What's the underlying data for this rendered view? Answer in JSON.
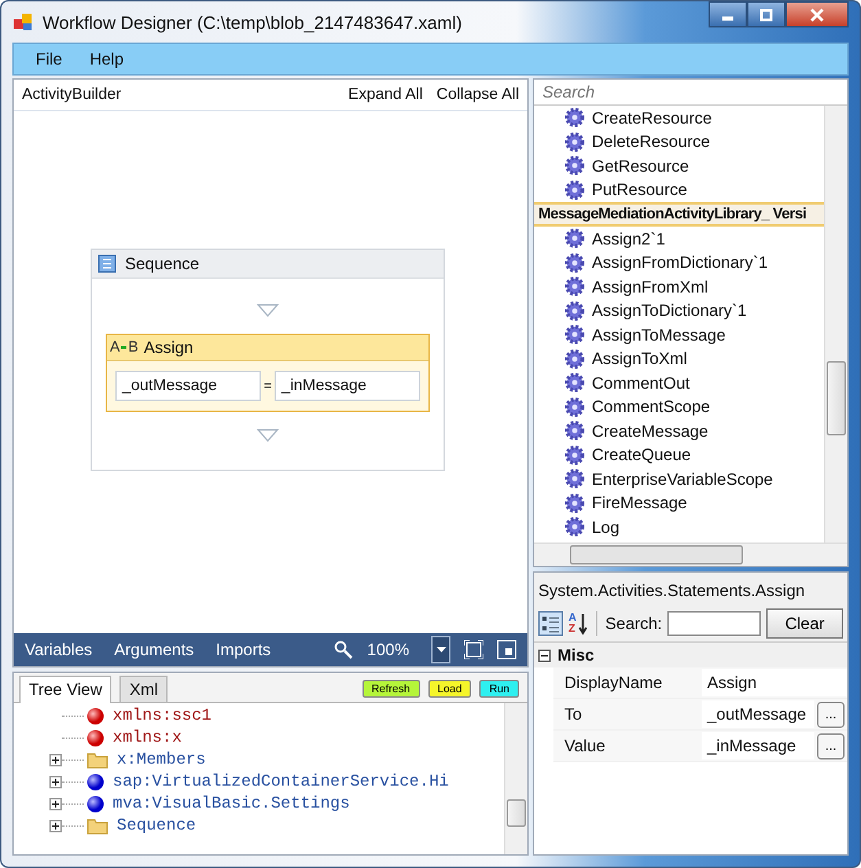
{
  "window": {
    "title": "Workflow Designer (C:\\temp\\blob_2147483647.xaml)"
  },
  "menu": [
    "File",
    "Help"
  ],
  "designer": {
    "breadcrumb": "ActivityBuilder",
    "actions": [
      "Expand All",
      "Collapse All"
    ],
    "sequence": {
      "title": "Sequence",
      "activity": {
        "icon_letters": [
          "A",
          "B"
        ],
        "title": "Assign",
        "selected": true,
        "to": "_outMessage",
        "operator": "=",
        "value": "_inMessage"
      }
    }
  },
  "designer_bar": {
    "tabs": [
      "Variables",
      "Arguments",
      "Imports"
    ],
    "zoom": "100%"
  },
  "tree_panel": {
    "tabs": [
      {
        "label": "Tree View",
        "selected": true
      },
      {
        "label": "Xml",
        "selected": false
      }
    ],
    "buttons": [
      {
        "label": "Refresh",
        "color": "#b5f53a"
      },
      {
        "label": "Load",
        "color": "#f5f52a"
      },
      {
        "label": "Run",
        "color": "#2ef0f0"
      }
    ],
    "items": [
      {
        "label": "xmlns:ssc1",
        "kind": "attribute",
        "expandable": false
      },
      {
        "label": "xmlns:x",
        "kind": "attribute",
        "expandable": false
      },
      {
        "label": "x:Members",
        "kind": "folder",
        "expandable": true
      },
      {
        "label": "sap:VirtualizedContainerService.Hi",
        "kind": "element",
        "expandable": true
      },
      {
        "label": "mva:VisualBasic.Settings",
        "kind": "element",
        "expandable": true
      },
      {
        "label": "Sequence",
        "kind": "folder",
        "expandable": true
      }
    ]
  },
  "toolbox": {
    "search": {
      "placeholder": "Search"
    },
    "groups": [
      {
        "items": [
          "CreateResource",
          "DeleteResource",
          "GetResource",
          "PutResource"
        ]
      },
      {
        "title": "MessageMediationActivityLibrary_ Versi",
        "items": [
          "Assign2`1",
          "AssignFromDictionary`1",
          "AssignFromXml",
          "AssignToDictionary`1",
          "AssignToMessage",
          "AssignToXml",
          "CommentOut",
          "CommentScope",
          "CreateMessage",
          "CreateQueue",
          "EnterpriseVariableScope",
          "FireMessage",
          "Log"
        ]
      }
    ]
  },
  "properties": {
    "type_name": "System.Activities.Statements.Assign",
    "sort_letters": [
      "A",
      "Z"
    ],
    "search_label": "Search:",
    "clear": "Clear",
    "category": {
      "title": "Misc",
      "expanded": true
    },
    "rows": [
      {
        "name": "DisplayName",
        "value": "Assign",
        "has_editor": false
      },
      {
        "name": "To",
        "value": "_outMessage",
        "has_editor": true,
        "editor_label": "..."
      },
      {
        "name": "Value",
        "value": "_inMessage",
        "has_editor": true,
        "editor_label": "..."
      }
    ]
  }
}
